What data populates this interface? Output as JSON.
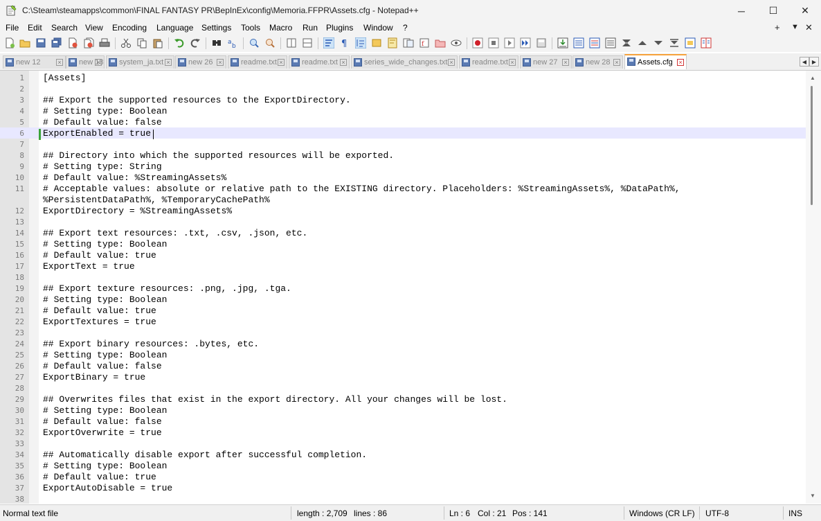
{
  "window": {
    "title": "C:\\Steam\\steamapps\\common\\FINAL FANTASY PR\\BepInEx\\config\\Memoria.FFPR\\Assets.cfg - Notepad++",
    "minimize_label": "─",
    "maximize_label": "☐",
    "close_label": "✕"
  },
  "menu": {
    "items": [
      "File",
      "Edit",
      "Search",
      "View",
      "Encoding",
      "Language",
      "Settings",
      "Tools",
      "Macro",
      "Run",
      "Plugins",
      "Window",
      "?"
    ],
    "right_plus": "+",
    "right_down": "▼",
    "right_close": "✕"
  },
  "toolbar": {
    "icons": [
      "new-file",
      "open-file",
      "save",
      "save-all",
      "close",
      "close-all",
      "print",
      "cut",
      "copy",
      "paste",
      "undo",
      "redo",
      "find",
      "replace",
      "zoom-in",
      "zoom-out",
      "sync-vertical",
      "sync-horizontal",
      "word-wrap",
      "show-all-chars",
      "indent-guide",
      "udl",
      "doc-map",
      "function-list",
      "folder-workspace",
      "clear",
      "monitor",
      "record-macro",
      "stop-record",
      "play-macro",
      "run-macro-multiple",
      "save-macro",
      "plugin-1",
      "plugin-2",
      "plugin-3",
      "plugin-4",
      "plugin-5",
      "plugin-6",
      "plugin-7",
      "plugin-8",
      "plugin-9",
      "plugin-10"
    ]
  },
  "tabs": [
    {
      "label": "new 12",
      "active": false
    },
    {
      "label": "new 18",
      "active": false
    },
    {
      "label": "system_ja.txt",
      "active": false
    },
    {
      "label": "new 26",
      "active": false
    },
    {
      "label": "readme.txt",
      "active": false
    },
    {
      "label": "readme.txt",
      "active": false
    },
    {
      "label": "series_wide_changes.txt",
      "active": false
    },
    {
      "label": "readme.txt",
      "active": false
    },
    {
      "label": "new 27",
      "active": false
    },
    {
      "label": "new 28",
      "active": false
    },
    {
      "label": "Assets.cfg",
      "active": true
    }
  ],
  "tab_nav": {
    "left": "◀",
    "right": "▶"
  },
  "editor": {
    "current_line": 6,
    "lines": [
      {
        "n": "1",
        "text": "[Assets]"
      },
      {
        "n": "2",
        "text": ""
      },
      {
        "n": "3",
        "text": "## Export the supported resources to the ExportDirectory."
      },
      {
        "n": "4",
        "text": "# Setting type: Boolean"
      },
      {
        "n": "5",
        "text": "# Default value: false"
      },
      {
        "n": "6",
        "text": "ExportEnabled = true"
      },
      {
        "n": "7",
        "text": ""
      },
      {
        "n": "8",
        "text": "## Directory into which the supported resources will be exported."
      },
      {
        "n": "9",
        "text": "# Setting type: String"
      },
      {
        "n": "10",
        "text": "# Default value: %StreamingAssets%"
      },
      {
        "n": "11",
        "text": "# Acceptable values: absolute or relative path to the EXISTING directory. Placeholders: %StreamingAssets%, %DataPath%,"
      },
      {
        "n": "",
        "text": "%PersistentDataPath%, %TemporaryCachePath%"
      },
      {
        "n": "12",
        "text": "ExportDirectory = %StreamingAssets%"
      },
      {
        "n": "13",
        "text": ""
      },
      {
        "n": "14",
        "text": "## Export text resources: .txt, .csv, .json, etc."
      },
      {
        "n": "15",
        "text": "# Setting type: Boolean"
      },
      {
        "n": "16",
        "text": "# Default value: true"
      },
      {
        "n": "17",
        "text": "ExportText = true"
      },
      {
        "n": "18",
        "text": ""
      },
      {
        "n": "19",
        "text": "## Export texture resources: .png, .jpg, .tga."
      },
      {
        "n": "20",
        "text": "# Setting type: Boolean"
      },
      {
        "n": "21",
        "text": "# Default value: true"
      },
      {
        "n": "22",
        "text": "ExportTextures = true"
      },
      {
        "n": "23",
        "text": ""
      },
      {
        "n": "24",
        "text": "## Export binary resources: .bytes, etc."
      },
      {
        "n": "25",
        "text": "# Setting type: Boolean"
      },
      {
        "n": "26",
        "text": "# Default value: false"
      },
      {
        "n": "27",
        "text": "ExportBinary = true"
      },
      {
        "n": "28",
        "text": ""
      },
      {
        "n": "29",
        "text": "## Overwrites files that exist in the export directory. All your changes will be lost."
      },
      {
        "n": "30",
        "text": "# Setting type: Boolean"
      },
      {
        "n": "31",
        "text": "# Default value: false"
      },
      {
        "n": "32",
        "text": "ExportOverwrite = true"
      },
      {
        "n": "33",
        "text": ""
      },
      {
        "n": "34",
        "text": "## Automatically disable export after successful completion."
      },
      {
        "n": "35",
        "text": "# Setting type: Boolean"
      },
      {
        "n": "36",
        "text": "# Default value: true"
      },
      {
        "n": "37",
        "text": "ExportAutoDisable = true"
      },
      {
        "n": "38",
        "text": ""
      }
    ]
  },
  "statusbar": {
    "file_type": "Normal text file",
    "length": "length : 2,709",
    "lines": "lines : 86",
    "ln": "Ln : 6",
    "col": "Col : 21",
    "pos": "Pos : 141",
    "eol": "Windows (CR LF)",
    "encoding": "UTF-8",
    "mode": "INS"
  },
  "colors": {
    "current_line_bg": "#e8e8ff",
    "active_tab_accent": "#f7a23b",
    "gutter_bg": "#e4e4e4",
    "change_marker": "#3aa33a"
  }
}
